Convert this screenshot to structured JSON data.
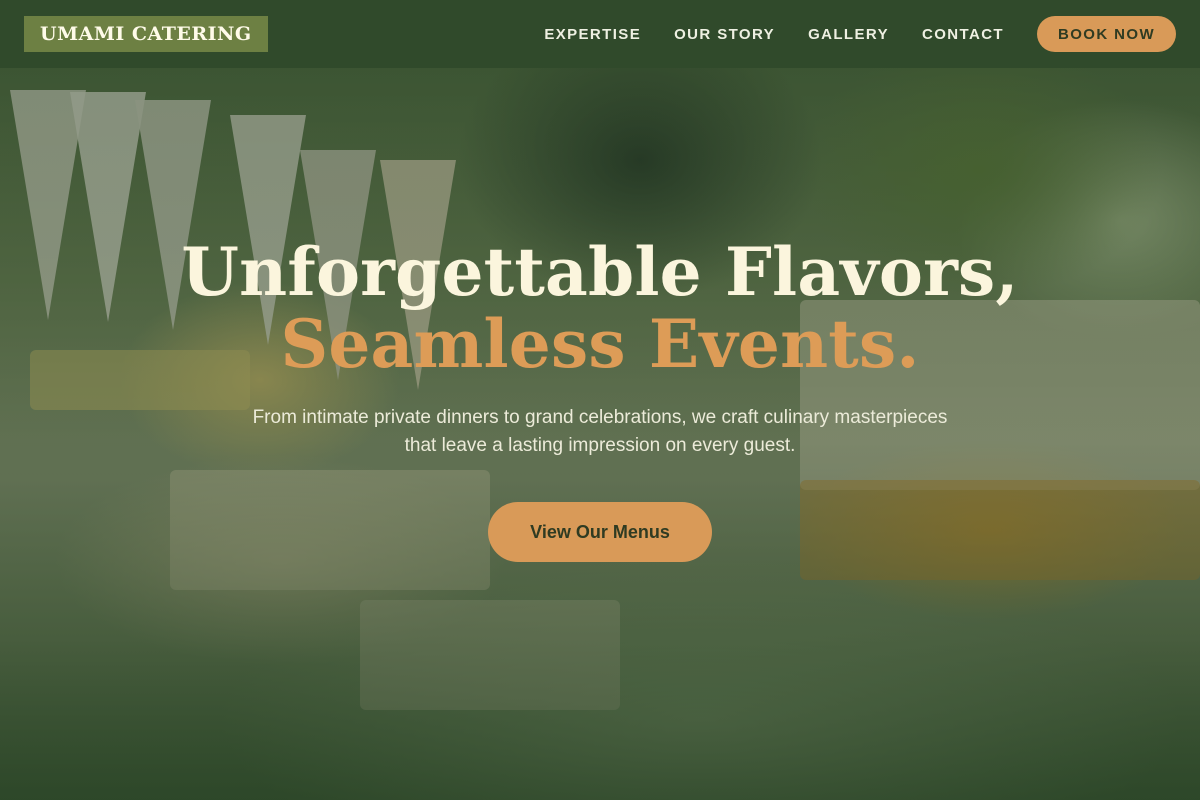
{
  "header": {
    "logo": "UMAMI CATERING",
    "nav": [
      "EXPERTISE",
      "OUR STORY",
      "GALLERY",
      "CONTACT"
    ],
    "cta": "BOOK NOW"
  },
  "hero": {
    "headline_line1": "Unforgettable Flavors,",
    "headline_line2": "Seamless Events.",
    "subtext": "From intimate private dinners to grand celebrations, we craft culinary masterpieces that leave a lasting impression on every guest.",
    "cta": "View Our Menus"
  },
  "colors": {
    "nav_bg": "#304a2b",
    "logo_bg": "#6d8043",
    "accent": "#d99a58",
    "headline_light": "#fbf5dd",
    "headline_accent": "#dd9c57"
  }
}
